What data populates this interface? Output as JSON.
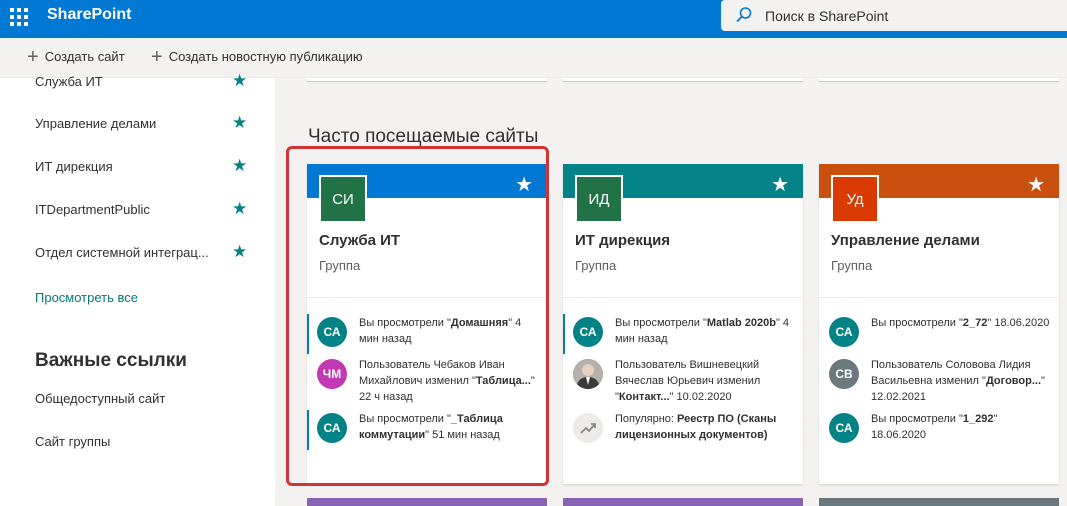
{
  "app": {
    "title": "SharePoint"
  },
  "search": {
    "placeholder": "Поиск в SharePoint"
  },
  "commands": {
    "create_site": "Создать сайт",
    "create_news": "Создать новостную публикацию"
  },
  "sidebar": {
    "items": [
      {
        "label": "Служба ИТ"
      },
      {
        "label": "Управление делами"
      },
      {
        "label": "ИТ дирекция"
      },
      {
        "label": "ITDepartmentPublic"
      },
      {
        "label": "Отдел системной интеграц..."
      }
    ],
    "view_all": "Просмотреть все",
    "links_title": "Важные ссылки",
    "links": [
      {
        "label": "Общедоступный сайт"
      },
      {
        "label": "Сайт группы"
      }
    ]
  },
  "main": {
    "section_title": "Часто посещаемые сайты",
    "cards": [
      {
        "initials": "СИ",
        "title": "Служба ИТ",
        "subtitle": "Группа",
        "band_color": "#0078d4",
        "logo_color": "#217346",
        "activities": [
          {
            "avatar": "СА",
            "avatar_color": "#038387",
            "pre": "Вы просмотрели \"",
            "bold": "Домашняя",
            "post": "\" 4 мин назад"
          },
          {
            "avatar": "ЧМ",
            "avatar_color": "#c239b3",
            "pre": "Пользователь Чебаков Иван Михайлович изменил \"",
            "bold": "Таблица...",
            "post": "\" 22 ч назад"
          },
          {
            "avatar": "СА",
            "avatar_color": "#038387",
            "pre": "Вы просмотрели \"",
            "bold": "_Таблица коммутации",
            "post": "\" 51 мин назад"
          }
        ]
      },
      {
        "initials": "ИД",
        "title": "ИТ дирекция",
        "subtitle": "Группа",
        "band_color": "#038387",
        "logo_color": "#217346",
        "activities": [
          {
            "avatar": "СА",
            "avatar_color": "#038387",
            "pre": "Вы просмотрели \"",
            "bold": "Matlab 2020b",
            "post": "\" 4 мин назад"
          },
          {
            "avatar": "photo",
            "avatar_color": "#8a8886",
            "pre": "Пользователь Вишневецкий Вячеслав Юрьевич изменил \"",
            "bold": "Контакт...",
            "post": "\" 10.02.2020"
          },
          {
            "avatar": "trend",
            "avatar_color": "#edebe9",
            "pre": "Популярно: ",
            "bold": "Реестр ПО (Сканы лицензионных документов)",
            "post": ""
          }
        ]
      },
      {
        "initials": "Уд",
        "title": "Управление делами",
        "subtitle": "Группа",
        "band_color": "#ca5010",
        "logo_color": "#d83b01",
        "activities": [
          {
            "avatar": "СА",
            "avatar_color": "#038387",
            "pre": "Вы просмотрели \"",
            "bold": "2_72",
            "post": "\" 18.06.2020"
          },
          {
            "avatar": "СВ",
            "avatar_color": "#69797e",
            "pre": "Пользователь Соловова Лидия Васильевна изменил \"",
            "bold": "Договор...",
            "post": "\" 12.02.2021"
          },
          {
            "avatar": "СА",
            "avatar_color": "#038387",
            "pre": "Вы просмотрели \"",
            "bold": "1_292",
            "post": "\" 18.06.2020"
          }
        ]
      }
    ],
    "bottom_band_colors": [
      "#8764b8",
      "#8764b8",
      "#69797e"
    ]
  },
  "colors": {
    "accent": "#0078d4",
    "teal": "#038387",
    "highlight": "#d13438"
  }
}
